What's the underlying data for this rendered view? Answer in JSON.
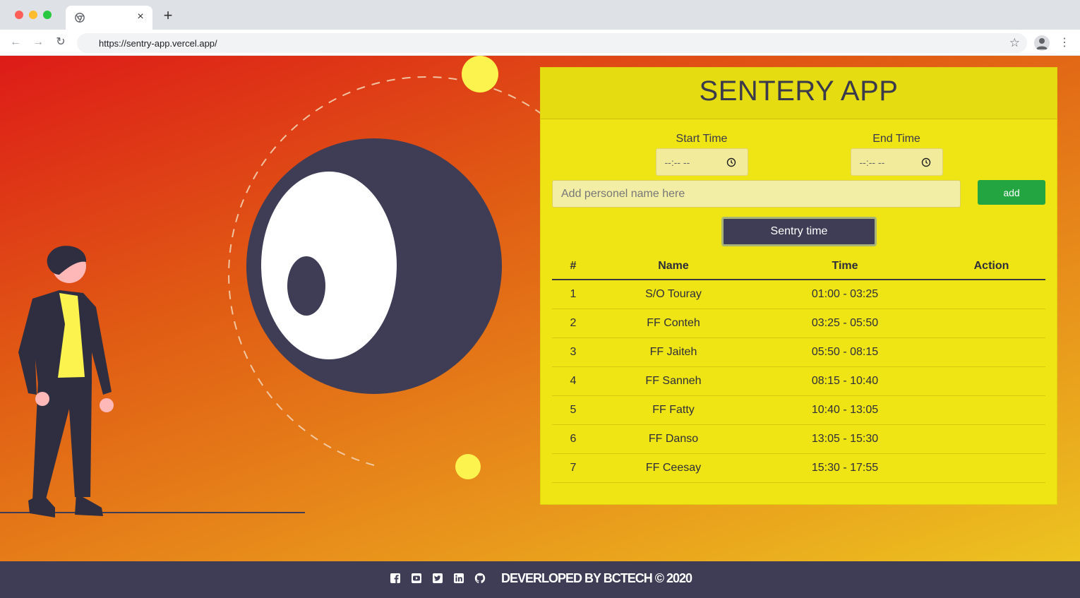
{
  "browser": {
    "tab_title": "",
    "tab_close": "×",
    "new_tab": "+",
    "back": "←",
    "forward": "→",
    "reload": "↻",
    "url": "https://sentry-app.vercel.app/",
    "bookmark": "☆",
    "menu": "⋮"
  },
  "panel": {
    "title": "SENTERY APP",
    "start_label": "Start Time",
    "start_value": "--:-- --",
    "end_label": "End Time",
    "end_value": "--:-- --",
    "name_placeholder": "Add personel name here",
    "add_label": "add",
    "sentry_label": "Sentry time"
  },
  "table": {
    "headers": {
      "num": "#",
      "name": "Name",
      "time": "Time",
      "action": "Action"
    },
    "rows": [
      {
        "num": "1",
        "name": "S/O Touray",
        "time": "01:00 - 03:25",
        "action": ""
      },
      {
        "num": "2",
        "name": "FF Conteh",
        "time": "03:25 - 05:50",
        "action": ""
      },
      {
        "num": "3",
        "name": "FF Jaiteh",
        "time": "05:50 - 08:15",
        "action": ""
      },
      {
        "num": "4",
        "name": "FF Sanneh",
        "time": "08:15 - 10:40",
        "action": ""
      },
      {
        "num": "5",
        "name": "FF Fatty",
        "time": "10:40 - 13:05",
        "action": ""
      },
      {
        "num": "6",
        "name": "FF Danso",
        "time": "13:05 - 15:30",
        "action": ""
      },
      {
        "num": "7",
        "name": "FF Ceesay",
        "time": "15:30 - 17:55",
        "action": ""
      }
    ]
  },
  "footer": {
    "text": "DEVERLOPED BY BCTECH © 2020",
    "icons": [
      "facebook-icon",
      "youtube-icon",
      "twitter-icon",
      "linkedin-icon",
      "github-icon"
    ]
  },
  "colors": {
    "panel": "#efe414",
    "dark": "#3f3d56",
    "add_button": "#23a642",
    "sun": "#fdf34f"
  }
}
